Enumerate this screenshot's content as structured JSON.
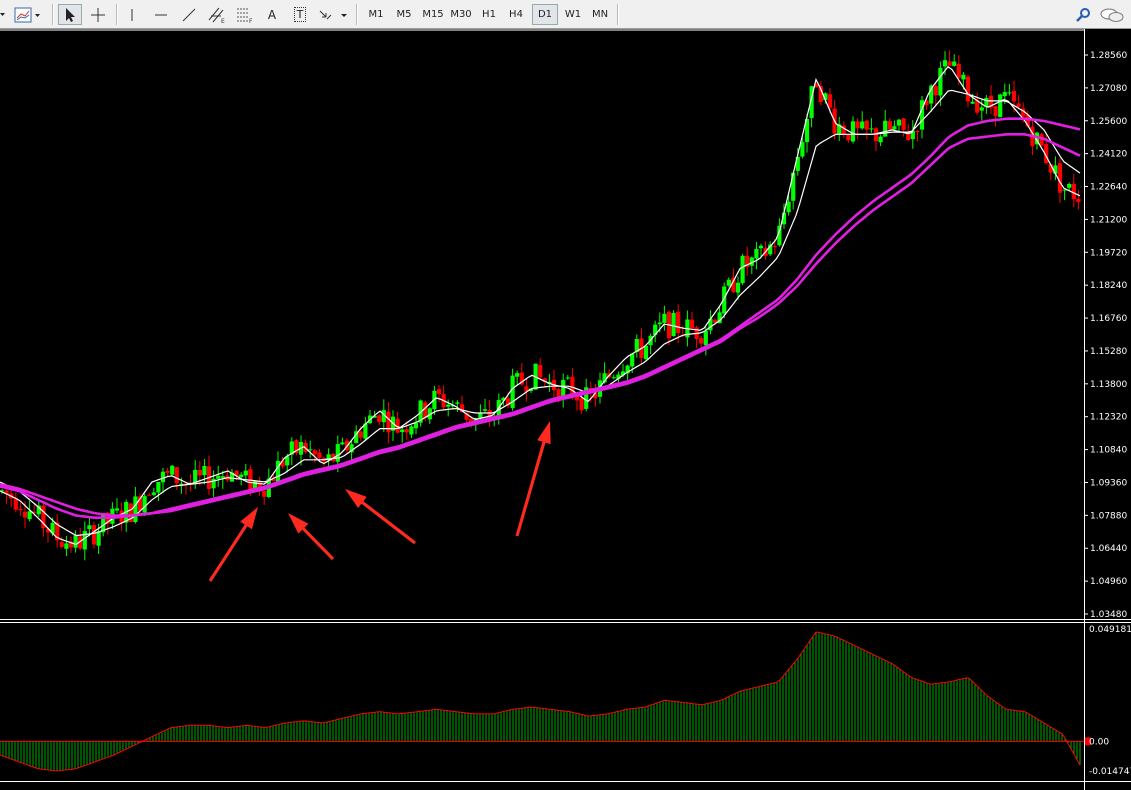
{
  "toolbar": {
    "timeframes": [
      "M1",
      "M5",
      "M15",
      "M30",
      "H1",
      "H4",
      "D1",
      "W1",
      "MN"
    ],
    "active_timeframe": "D1",
    "text_tool_label": "A",
    "textlabel_tool_label": "T"
  },
  "main_chart": {
    "type": "candlestick",
    "price_axis_labels": [
      "1.28560",
      "1.27080",
      "1.25600",
      "1.24120",
      "1.22640",
      "1.21200",
      "1.19720",
      "1.18240",
      "1.16760",
      "1.15280",
      "1.13800",
      "1.12320",
      "1.10840",
      "1.09360",
      "1.07880",
      "1.06440",
      "1.04960",
      "1.03480"
    ],
    "ylim": [
      1.0348,
      1.2856
    ],
    "moving_averages": [
      {
        "color": "#ffffff"
      },
      {
        "color": "#ffffff"
      },
      {
        "color": "#e020e0"
      },
      {
        "color": "#e020e0"
      }
    ],
    "bull_color": "#00ff00",
    "bear_color": "#ff0000",
    "annotation_arrows": 4,
    "arrow_color": "#ff2a1f"
  },
  "indicator": {
    "type": "histogram",
    "axis_labels": [
      "0.049181",
      "0.00",
      "-0.014747"
    ],
    "ylim": [
      -0.014747,
      0.049181
    ],
    "bar_color": "#00aa00",
    "line_color": "#ff0000"
  },
  "chart_data": [
    {
      "type": "line",
      "title": "",
      "ylim": [
        1.0348,
        1.2856
      ],
      "series": [
        {
          "values": [
            1.09,
            1.086,
            1.078,
            1.069,
            1.066,
            1.072,
            1.078,
            1.082,
            1.094,
            1.097,
            1.093,
            1.096,
            1.099,
            1.094,
            1.093,
            1.105,
            1.11,
            1.102,
            1.107,
            1.118,
            1.126,
            1.118,
            1.124,
            1.132,
            1.128,
            1.122,
            1.124,
            1.136,
            1.142,
            1.138,
            1.136,
            1.13,
            1.141,
            1.15,
            1.155,
            1.165,
            1.163,
            1.162,
            1.174,
            1.19,
            1.194,
            1.204,
            1.24,
            1.275,
            1.255,
            1.25,
            1.25,
            1.252,
            1.25,
            1.27,
            1.281,
            1.268,
            1.262,
            1.266,
            1.256,
            1.242,
            1.226,
            1.222
          ]
        },
        {
          "values": [
            1.094,
            1.09,
            1.083,
            1.075,
            1.07,
            1.071,
            1.074,
            1.078,
            1.086,
            1.092,
            1.093,
            1.094,
            1.096,
            1.095,
            1.094,
            1.098,
            1.104,
            1.104,
            1.105,
            1.111,
            1.118,
            1.118,
            1.121,
            1.126,
            1.127,
            1.125,
            1.125,
            1.13,
            1.136,
            1.137,
            1.137,
            1.134,
            1.137,
            1.143,
            1.148,
            1.156,
            1.16,
            1.161,
            1.167,
            1.178,
            1.186,
            1.195,
            1.215,
            1.245,
            1.25,
            1.25,
            1.25,
            1.251,
            1.251,
            1.26,
            1.27,
            1.268,
            1.265,
            1.265,
            1.26,
            1.252,
            1.238,
            1.232
          ]
        },
        {
          "values": [
            1.093,
            1.091,
            1.088,
            1.085,
            1.082,
            1.08,
            1.079,
            1.079,
            1.08,
            1.082,
            1.084,
            1.086,
            1.088,
            1.09,
            1.092,
            1.095,
            1.098,
            1.1,
            1.102,
            1.105,
            1.108,
            1.11,
            1.113,
            1.116,
            1.119,
            1.121,
            1.123,
            1.125,
            1.128,
            1.131,
            1.133,
            1.135,
            1.137,
            1.139,
            1.142,
            1.146,
            1.15,
            1.154,
            1.158,
            1.164,
            1.17,
            1.176,
            1.185,
            1.196,
            1.205,
            1.213,
            1.22,
            1.226,
            1.232,
            1.24,
            1.249,
            1.254,
            1.256,
            1.257,
            1.257,
            1.256,
            1.254,
            1.252
          ]
        },
        {
          "values": [
            1.092,
            1.09,
            1.086,
            1.082,
            1.079,
            1.078,
            1.078,
            1.079,
            1.08,
            1.081,
            1.083,
            1.085,
            1.087,
            1.089,
            1.091,
            1.094,
            1.097,
            1.099,
            1.101,
            1.104,
            1.107,
            1.109,
            1.112,
            1.115,
            1.118,
            1.12,
            1.122,
            1.124,
            1.127,
            1.13,
            1.132,
            1.134,
            1.136,
            1.138,
            1.141,
            1.145,
            1.149,
            1.153,
            1.157,
            1.163,
            1.168,
            1.174,
            1.182,
            1.192,
            1.201,
            1.209,
            1.216,
            1.222,
            1.228,
            1.236,
            1.244,
            1.248,
            1.249,
            1.25,
            1.25,
            1.248,
            1.244,
            1.24
          ]
        }
      ]
    },
    {
      "type": "bar",
      "title": "",
      "ylim": [
        -0.014747,
        0.049181
      ],
      "values": [
        -0.006,
        -0.009,
        -0.012,
        -0.013,
        -0.012,
        -0.009,
        -0.006,
        -0.002,
        0.002,
        0.006,
        0.007,
        0.007,
        0.006,
        0.007,
        0.006,
        0.008,
        0.009,
        0.008,
        0.01,
        0.012,
        0.013,
        0.012,
        0.013,
        0.014,
        0.013,
        0.012,
        0.012,
        0.014,
        0.015,
        0.014,
        0.013,
        0.011,
        0.012,
        0.014,
        0.015,
        0.018,
        0.017,
        0.016,
        0.018,
        0.022,
        0.024,
        0.026,
        0.036,
        0.048,
        0.046,
        0.042,
        0.038,
        0.034,
        0.028,
        0.025,
        0.026,
        0.028,
        0.02,
        0.014,
        0.013,
        0.008,
        0.003,
        -0.012
      ]
    }
  ]
}
